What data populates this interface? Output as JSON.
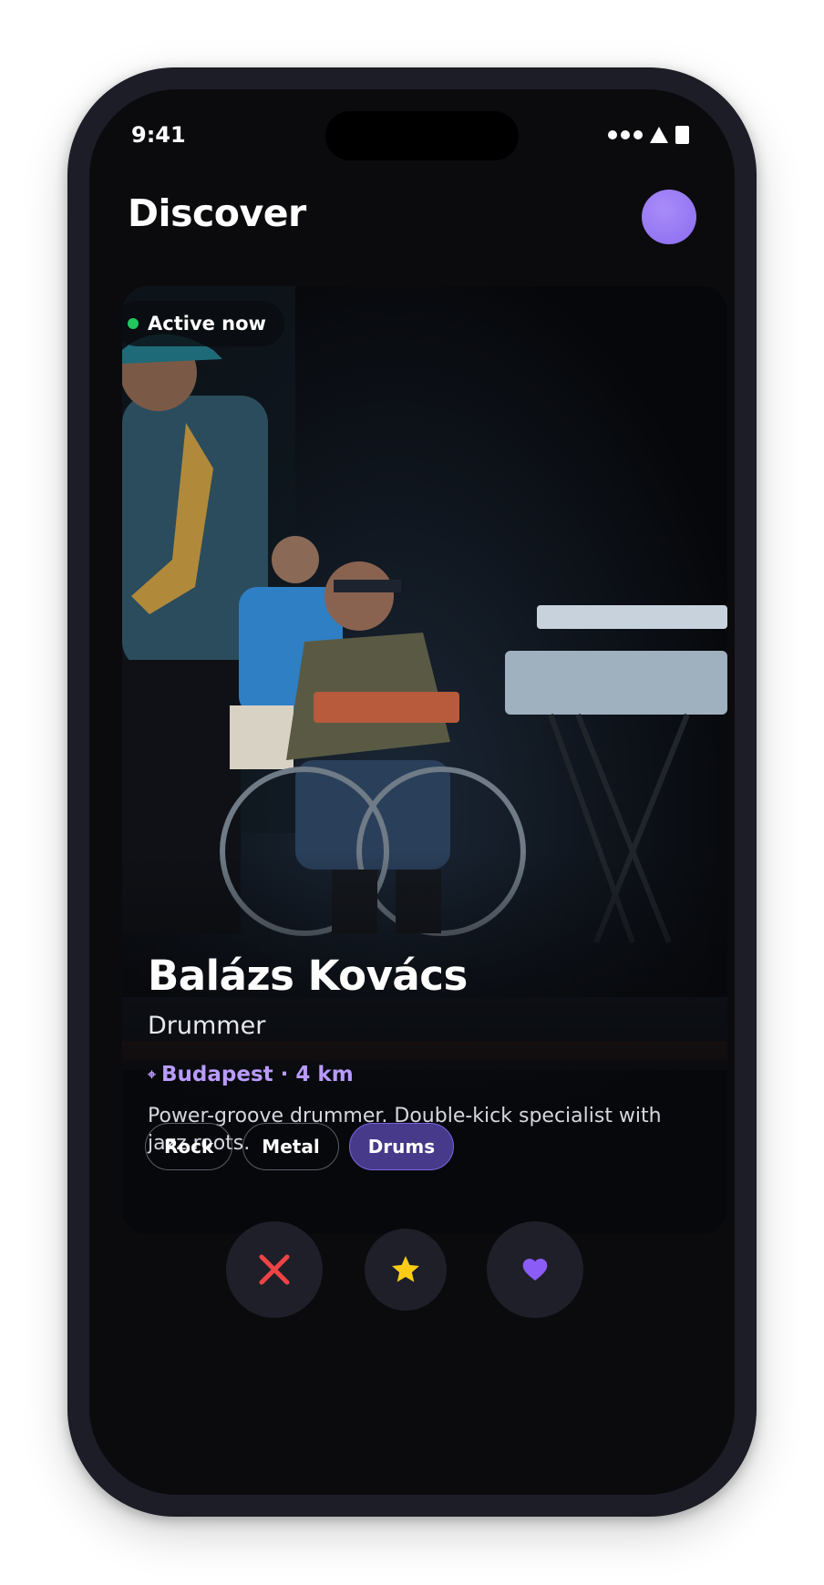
{
  "status_bar": {
    "time": "9:41"
  },
  "header": {
    "title": "Discover"
  },
  "profile": {
    "active_label": "Active now",
    "name": "Balázs Kovács",
    "role": "Drummer",
    "location": "Budapest · 4 km",
    "bio": "Power-groove drummer. Double-kick specialist with jazz roots.",
    "tags": [
      "Rock",
      "Metal",
      "Drums"
    ]
  },
  "actions": {
    "pass_icon": "close-icon",
    "super_icon": "star-icon",
    "like_icon": "heart-icon"
  },
  "colors": {
    "accent": "#8b6bf0",
    "online": "#22c55e",
    "pass": "#ef4444",
    "super": "#facc15",
    "like": "#8b5cf6"
  }
}
